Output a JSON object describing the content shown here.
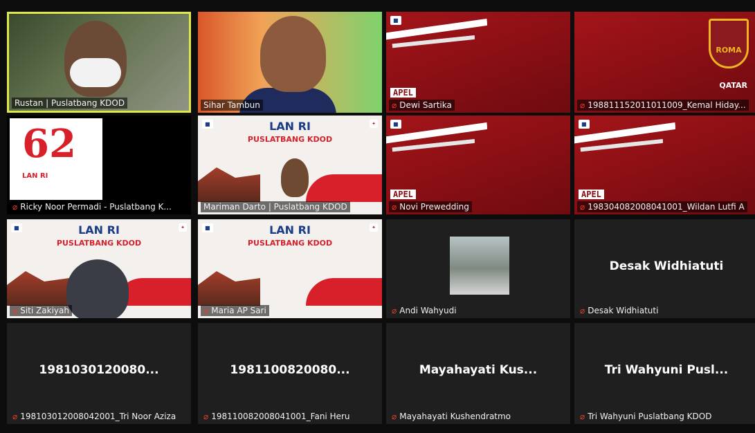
{
  "participants": [
    {
      "name": "Rustan | Puslatbang KDOD",
      "muted": false,
      "feed": "camera"
    },
    {
      "name": "Sihar Tambun",
      "muted": false,
      "feed": "camera"
    },
    {
      "name": "Dewi Sartika",
      "muted": true,
      "feed": "apel",
      "overlay": "APEL"
    },
    {
      "name": "198811152011011009_Kemal Hiday...",
      "muted": true,
      "feed": "roma",
      "logo_text": "ROMA",
      "sponsor": "QATAR"
    },
    {
      "name": "Ricky Noor Permadi - Puslatbang K...",
      "muted": true,
      "feed": "poster62",
      "poster_number": "62",
      "poster_text": "LAN RI"
    },
    {
      "name": "Mariman Darto | Puslatbang KDOD",
      "muted": false,
      "feed": "slide",
      "slide_title": "LAN RI",
      "slide_subtitle": "PUSLATBANG KDOD"
    },
    {
      "name": "Novi Prewedding",
      "muted": true,
      "feed": "apel",
      "overlay": "APEL"
    },
    {
      "name": "198304082008041001_Wildan Lutfi A",
      "muted": true,
      "feed": "apel",
      "overlay": "APEL"
    },
    {
      "name": "Siti Zakiyah",
      "muted": true,
      "feed": "slide",
      "slide_title": "LAN RI",
      "slide_subtitle": "PUSLATBANG KDOD"
    },
    {
      "name": "Maria AP Sari",
      "muted": true,
      "feed": "slide",
      "slide_title": "LAN RI",
      "slide_subtitle": "PUSLATBANG KDOD"
    },
    {
      "name": "Andi Wahyudi",
      "muted": true,
      "feed": "mini"
    },
    {
      "name": "Desak Widhiatuti",
      "muted": true,
      "feed": "off",
      "display_name": "Desak Widhiatuti"
    },
    {
      "name": "198103012008042001_Tri Noor Aziza",
      "muted": true,
      "feed": "off",
      "display_name": "1981030120080..."
    },
    {
      "name": "198110082008041001_Fani Heru",
      "muted": true,
      "feed": "off",
      "display_name": "1981100820080..."
    },
    {
      "name": "Mayahayati Kushendratmo",
      "muted": true,
      "feed": "off",
      "display_name": "Mayahayati  Kus..."
    },
    {
      "name": "Tri Wahyuni Puslatbang KDOD",
      "muted": true,
      "feed": "off",
      "display_name": "Tri Wahyuni  Pusl..."
    }
  ],
  "active_speaker_index": 0,
  "colors": {
    "active_border": "#dfe84a",
    "mic_muted": "#e53b2c",
    "tile_bg": "#1f1f1f"
  },
  "icons": {
    "mic_muted": "mic-muted-icon"
  }
}
